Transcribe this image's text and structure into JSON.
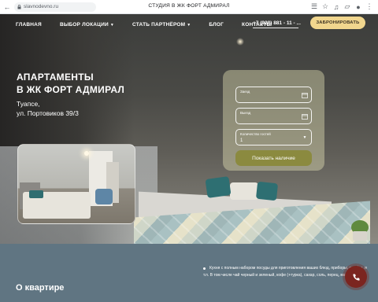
{
  "browser": {
    "url": "slavnodevno.ru",
    "tab_title": "СТУДИЯ В ЖК ФОРТ АДМИРАЛ",
    "icons": [
      "back-icon",
      "lock-icon",
      "translate-icon",
      "star-icon",
      "audio-icon",
      "extensions-icon",
      "profile-icon",
      "menu-icon"
    ]
  },
  "nav": {
    "items": [
      {
        "label": "ГЛАВНАЯ",
        "dropdown": false
      },
      {
        "label": "ВЫБОР ЛОКАЦИИ",
        "dropdown": true
      },
      {
        "label": "СТАТЬ ПАРТНЁРОМ",
        "dropdown": true
      },
      {
        "label": "БЛОГ",
        "dropdown": false
      },
      {
        "label": "КОНТАКТЫ",
        "dropdown": false
      }
    ],
    "phone": "+7 (928) 881 - 11 - ...",
    "book_label": "ЗАБРОНИРОВАТЬ"
  },
  "hero": {
    "title_line1": "АПАРТАМЕНТЫ",
    "title_line2": "В ЖК ФОРТ АДМИРАЛ",
    "city": "Туапсе,",
    "street": "ул. Портовиков 39/3"
  },
  "form": {
    "checkin_label": "Заезд",
    "checkout_label": "Выезд",
    "guests_label": "Количество гостей",
    "guests_value": "1",
    "submit_label": "Показать наличие"
  },
  "about": {
    "heading": "О квартире",
    "amenities": [
      "Кухня с полным набором посуды для приготовления ваших блюд, приборы, шкафы, и",
      "т.п. В том числе чай черный и зеленый, кофе (+турка), сахар, соль, перец, масло."
    ]
  },
  "colors": {
    "accent": "#f1d68e",
    "form_button": "#8b8a3f",
    "section_bg": "#607582",
    "call_button": "#7b2520"
  }
}
